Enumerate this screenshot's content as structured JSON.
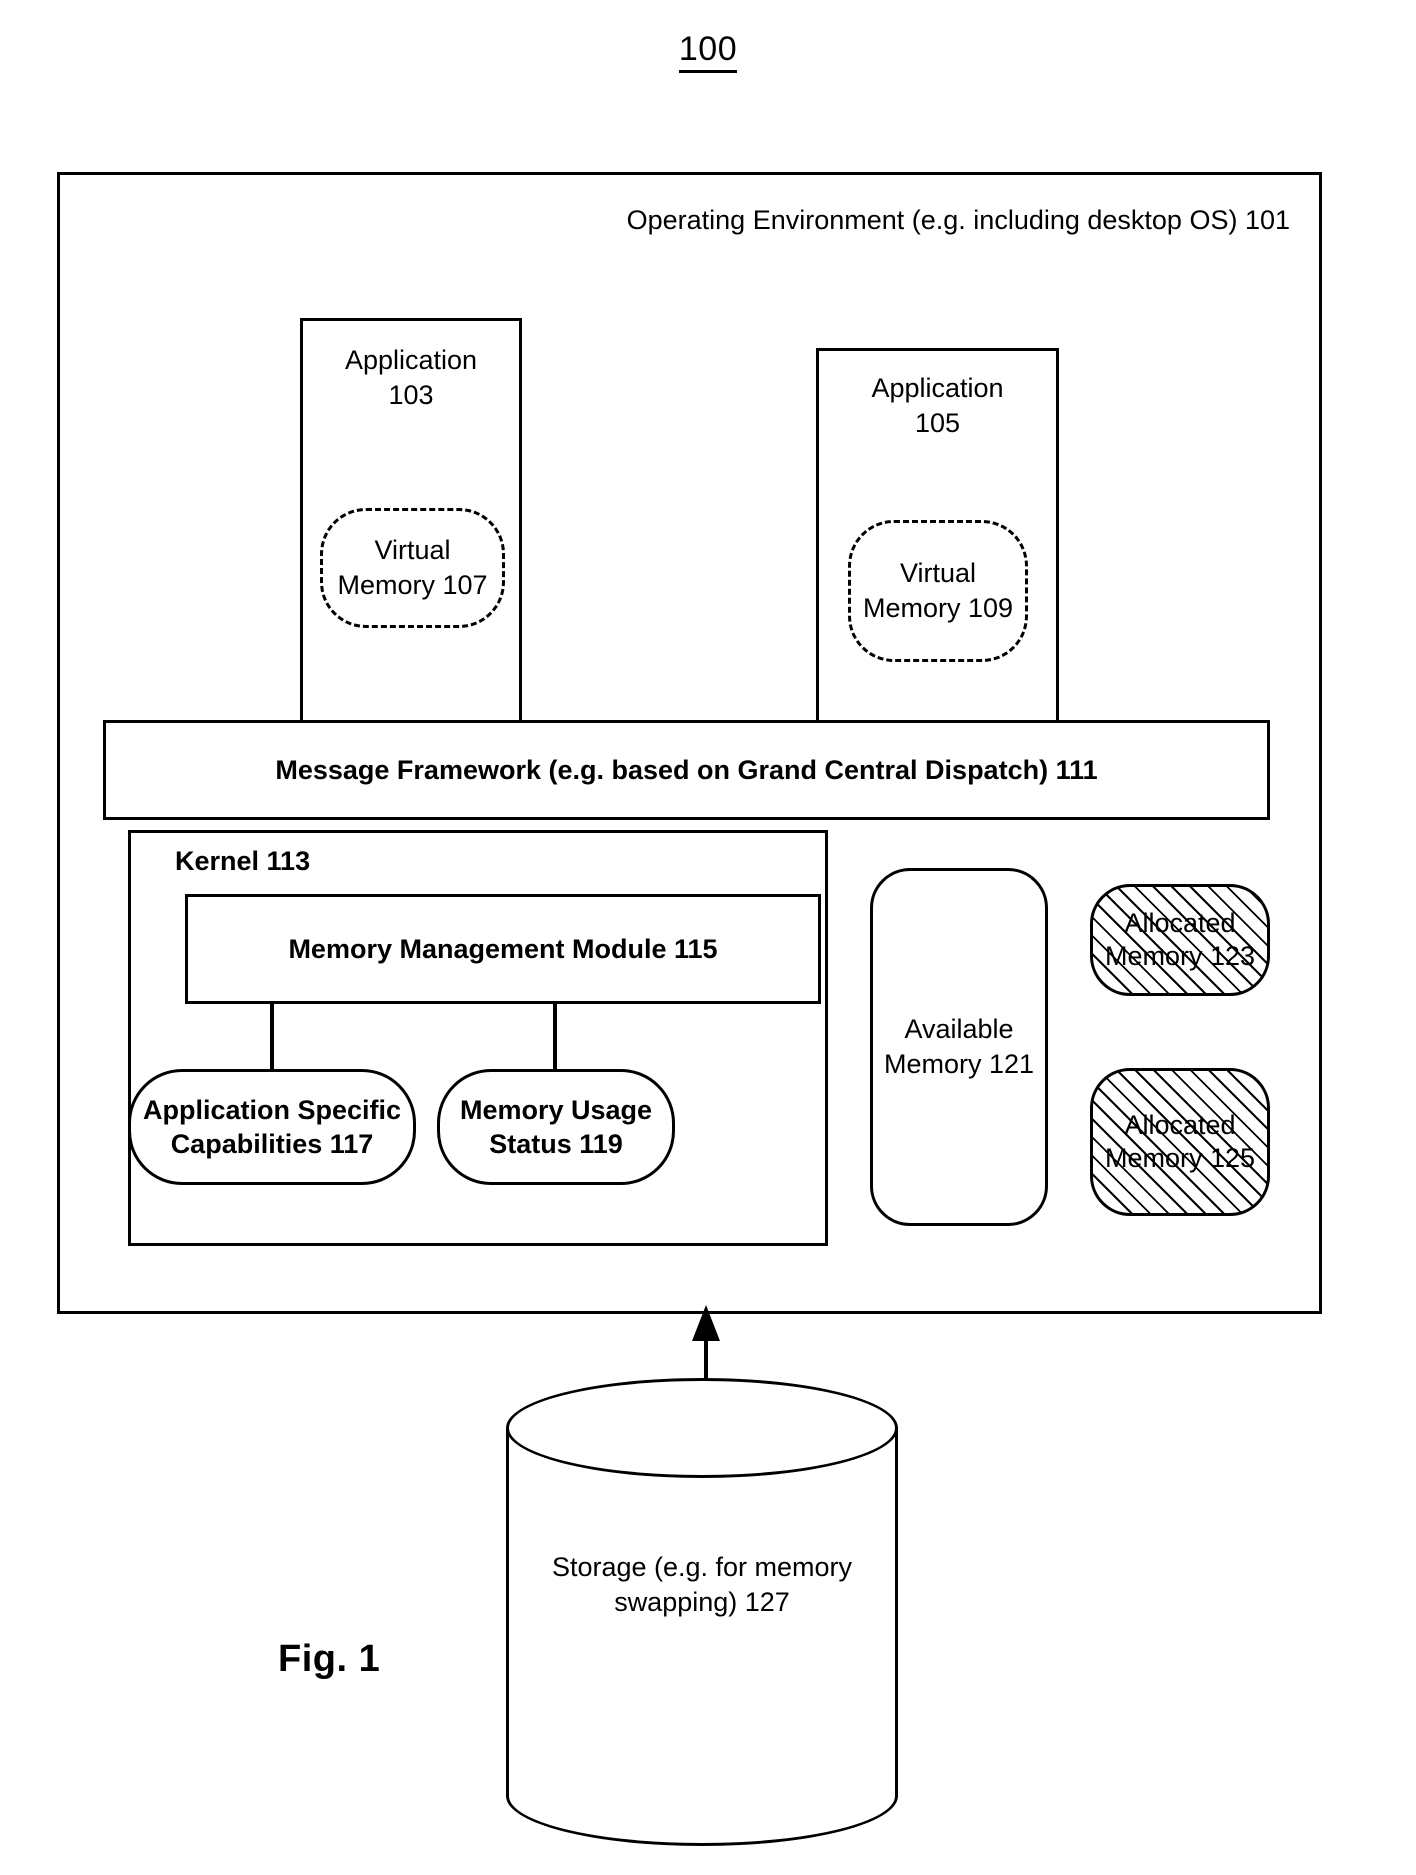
{
  "figure": {
    "number": "100",
    "caption": "Fig. 1"
  },
  "operating_environment": {
    "title": "Operating Environment (e.g. including desktop OS) 101"
  },
  "applications": [
    {
      "label_line1": "Application",
      "label_line2": "103",
      "virtual_memory": "Virtual Memory 107"
    },
    {
      "label_line1": "Application",
      "label_line2": "105",
      "virtual_memory": "Virtual Memory 109"
    }
  ],
  "message_framework": {
    "label": "Message Framework (e.g. based on Grand Central Dispatch) 111"
  },
  "kernel": {
    "label": "Kernel 113",
    "memory_management_module": "Memory Management Module 115",
    "leaves": [
      {
        "label": "Application Specific Capabilities 117"
      },
      {
        "label": "Memory Usage Status 119"
      }
    ]
  },
  "memory_blocks": {
    "available": "Available Memory 121",
    "allocated_1": "Allocated Memory 123",
    "allocated_2": "Allocated Memory 125"
  },
  "storage": {
    "label": "Storage (e.g. for memory swapping) 127"
  },
  "colors": {
    "stroke": "#000000",
    "background": "#ffffff"
  }
}
